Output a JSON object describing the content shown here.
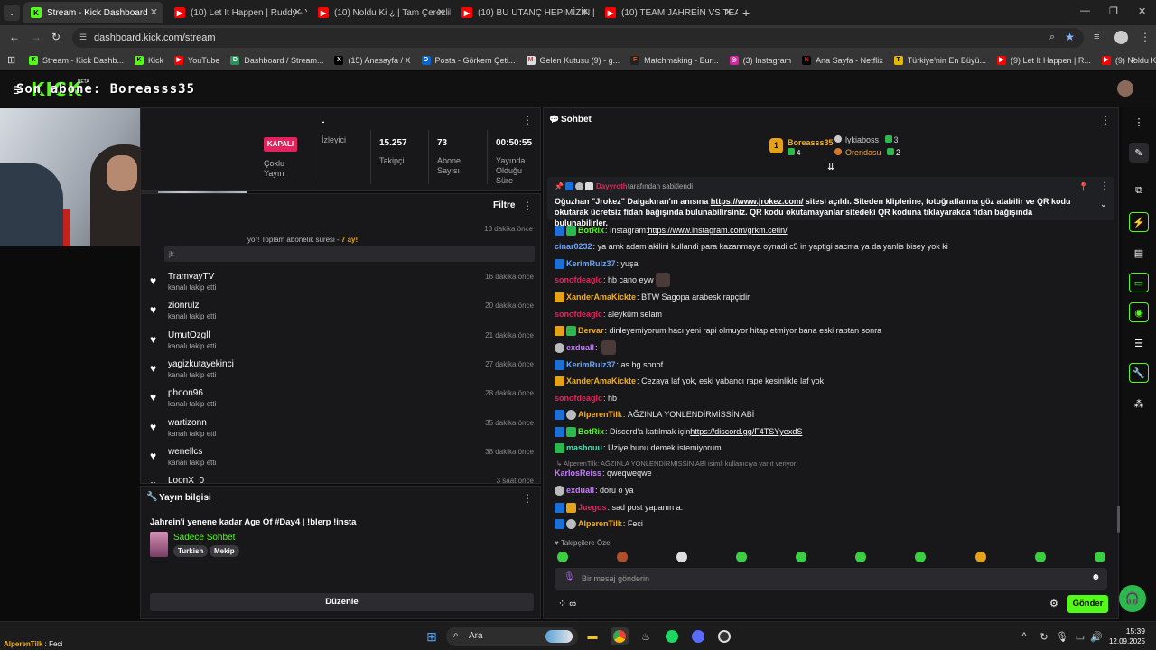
{
  "browser": {
    "tabs": [
      {
        "title": "Stream - Kick Dashboard",
        "icon": "kick-icon"
      },
      {
        "title": "(10) Let It Happen | Ruddy - Yo",
        "icon": "youtube-icon"
      },
      {
        "title": "(10) Noldu Ki ¿ | Tam Çerezlik |",
        "icon": "youtube-icon"
      },
      {
        "title": "(10) BU UTANÇ HEPİMİZİN | Ma",
        "icon": "youtube-icon"
      },
      {
        "title": "(10) TEAM JAHREİN VS TEAM C",
        "icon": "youtube-icon"
      }
    ],
    "url": "dashboard.kick.com/stream",
    "bookmarks": [
      "Stream - Kick Dashb...",
      "Kick",
      "YouTube",
      "Dashboard / Stream...",
      "(15) Anasayfa / X",
      "Posta - Görkem Çeti...",
      "Gelen Kutusu (9) - g...",
      "Matchmaking - Eur...",
      "(3) Instagram",
      "Ana Sayfa - Netflix",
      "Türkiye'nin En Büyü...",
      "(9) Let It Happen | R...",
      "(9) Noldu Ki ¿ | Tam..."
    ]
  },
  "header": {
    "logo": "KICK",
    "beta": "BETA",
    "overlay_text": "Son abone: Boreasss35"
  },
  "stream_panel": {
    "status": "KAPALI",
    "status_label": "Çoklu Yayın",
    "stats": [
      {
        "value": "-",
        "label": "İzleyici"
      },
      {
        "value": "15.257",
        "label": "Takipçi"
      },
      {
        "value": "73",
        "label": "Abone Sayısı"
      },
      {
        "value": "00:50:55",
        "label": "Yayında Olduğu Süre"
      }
    ]
  },
  "activity": {
    "filter": "Filtre",
    "first_time": "13 dakika önce",
    "first_msg": "yor! Toplam abonelik süresi - ",
    "first_months": "7 ay!",
    "first_note": "jk",
    "events": [
      {
        "name": "TramvayTV",
        "sub": "kanalı takip etti",
        "time": "16 dakika önce"
      },
      {
        "name": "zionrulz",
        "sub": "kanalı takip etti",
        "time": "20 dakika önce"
      },
      {
        "name": "UmutOzgll",
        "sub": "kanalı takip etti",
        "time": "21 dakika önce"
      },
      {
        "name": "yagizkutayekinci",
        "sub": "kanalı takip etti",
        "time": "27 dakika önce"
      },
      {
        "name": "phoon96",
        "sub": "kanalı takip etti",
        "time": "28 dakika önce"
      },
      {
        "name": "wartizonn",
        "sub": "kanalı takip etti",
        "time": "35 dakika önce"
      },
      {
        "name": "wenellcs",
        "sub": "kanalı takip etti",
        "time": "38 dakika önce"
      },
      {
        "name": "LoonX_0",
        "sub": "",
        "time": "3 saat önce"
      }
    ]
  },
  "stream_info": {
    "title": "Yayın bilgisi",
    "stream_title": "Jahrein'i yenene kadar Age Of #Day4 | !blerp !insta",
    "category": "Sadece Sohbet",
    "tags": [
      "Turkish",
      "Mekip"
    ],
    "edit": "Düzenle"
  },
  "chat": {
    "title": "Sohbet",
    "top": [
      {
        "rank": "1",
        "name": "Boreasss35",
        "count": "4"
      },
      {
        "name": "lykiaboss",
        "count": "3"
      },
      {
        "name": "Orendasu",
        "count": "2"
      }
    ],
    "pinned_by_user": "Dayyroth",
    "pinned_by_text": "tarafından sabitlendi",
    "pinned_text_1": "Oğuzhan \"Jrokez\" Dalgakıran'ın anısına ",
    "pinned_link": "https://www.jrokez.com/",
    "pinned_text_2": " sitesi açıldı. Siteden kliplerine, fotoğraflarına göz atabilir ve QR kodu okutarak",
    "pinned_text_3": "ücretsiz fidan bağışında bulunabilirsiniz. QR kodu okutamayanlar sitedeki QR koduna tıklayarakda fidan bağışında bulunabilirler.",
    "messages": [
      {
        "user": "BotRix",
        "color": "#53fc18",
        "text": "Instagram: ",
        "link": "https://www.instagram.com/grkm.cetin/"
      },
      {
        "user": "cinar0232",
        "color": "#6aa8ff",
        "text": "ya amk adam akilini kullandi para kazanmaya oynadi c5 in yaptigi sacma ya da yanlis bisey yok ki"
      },
      {
        "user": "KerimRulz37",
        "color": "#6aa8ff",
        "text": "yuşa"
      },
      {
        "user": "sonofdeaglc",
        "color": "#e0245e",
        "text": "hb cano eyw"
      },
      {
        "user": "XanderAmaKickte",
        "color": "#f2b01e",
        "text": "BTW Sagopa arabesk rapçidir"
      },
      {
        "user": "sonofdeaglc",
        "color": "#e0245e",
        "text": "aleyküm selam"
      },
      {
        "user": "Bervar",
        "color": "#f2b01e",
        "text": "dinleyemiyorum hacı yeni rapi olmuyor hitap etmiyor bana eski raptan sonra"
      },
      {
        "user": "exduall",
        "color": "#c57cff",
        "text": ""
      },
      {
        "user": "KerimRulz37",
        "color": "#6aa8ff",
        "text": "as hg sonof"
      },
      {
        "user": "XanderAmaKickte",
        "color": "#f2b01e",
        "text": "Cezaya laf yok, eski yabancı rape kesinlikle laf yok"
      },
      {
        "user": "sonofdeaglc",
        "color": "#e0245e",
        "text": "hb"
      },
      {
        "user": "AlperenTilk",
        "color": "#f2b01e",
        "text": "AĞZINLA YONLENDİRMİSSİN ABİ"
      },
      {
        "user": "BotRix",
        "color": "#53fc18",
        "text": "Discord'a katılmak için ",
        "link": "https://discord.gg/F4TSYyexdS"
      },
      {
        "user": "mashouu",
        "color": "#4be0b0",
        "text": "Uziye bunu demek istemiyorum"
      },
      {
        "user": "KarlosReiss",
        "color": "#c57cff",
        "text": "qweqweqwe"
      },
      {
        "user": "exduall",
        "color": "#c57cff",
        "text": "doru o ya"
      },
      {
        "user": "Juegos",
        "color": "#e0245e",
        "text": "sad post yapanın a."
      },
      {
        "user": "AlperenTilk",
        "color": "#f2b01e",
        "text": "Feci"
      }
    ],
    "reply_hint": "AlperenTilk: AĞZINLA YONLENDİRMİSSİN ABİ isimli kullanıcıya yanıt veriyor",
    "followers_only": "Takipçilere Özel",
    "input_placeholder": "Bir mesaj gönderin",
    "send": "Gönder"
  },
  "taskbar": {
    "search": "Ara",
    "time": "15:39",
    "date": "12.09.2025",
    "tooltip_user": "AlperenTilk",
    "tooltip_msg": "Feci"
  }
}
